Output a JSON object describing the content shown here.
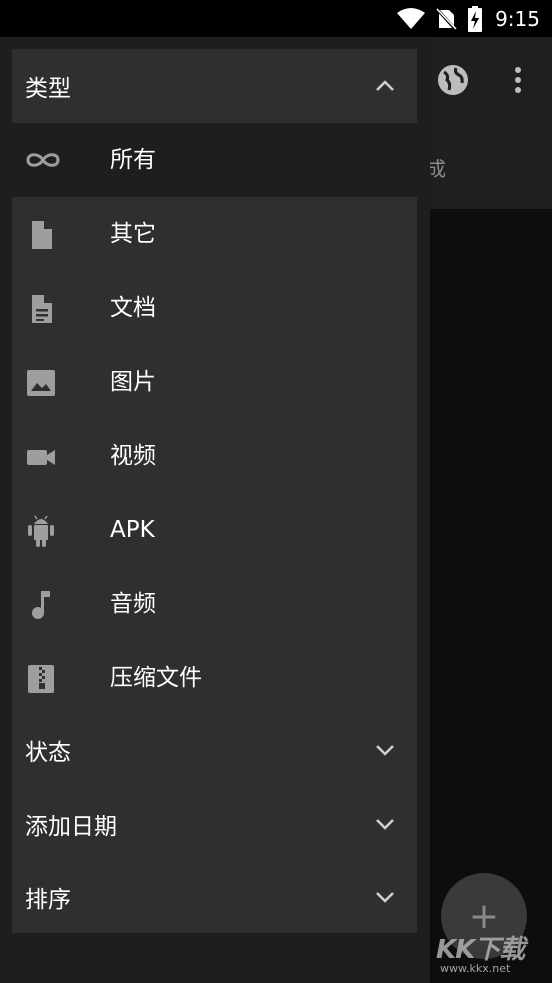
{
  "status": {
    "time": "9:15"
  },
  "app": {
    "tab_text": "成",
    "body_text": "/",
    "fab_symbol": "+"
  },
  "watermark": {
    "main": "KK下载",
    "url": "www.kkx.net"
  },
  "drawer": {
    "type_section": {
      "title": "类型"
    },
    "all_item": {
      "label": "所有"
    },
    "items": [
      {
        "label": "其它",
        "icon": "file-icon"
      },
      {
        "label": "文档",
        "icon": "document-icon"
      },
      {
        "label": "图片",
        "icon": "image-icon"
      },
      {
        "label": "视频",
        "icon": "video-icon"
      },
      {
        "label": "APK",
        "icon": "android-icon"
      },
      {
        "label": "音频",
        "icon": "music-note-icon"
      },
      {
        "label": "压缩文件",
        "icon": "archive-icon"
      }
    ],
    "sections": [
      {
        "title": "状态"
      },
      {
        "title": "添加日期"
      },
      {
        "title": "排序"
      }
    ]
  },
  "colors": {
    "icon": "#9e9e9e",
    "card": "#2f2f2f",
    "drawer": "#1e1e1e"
  }
}
